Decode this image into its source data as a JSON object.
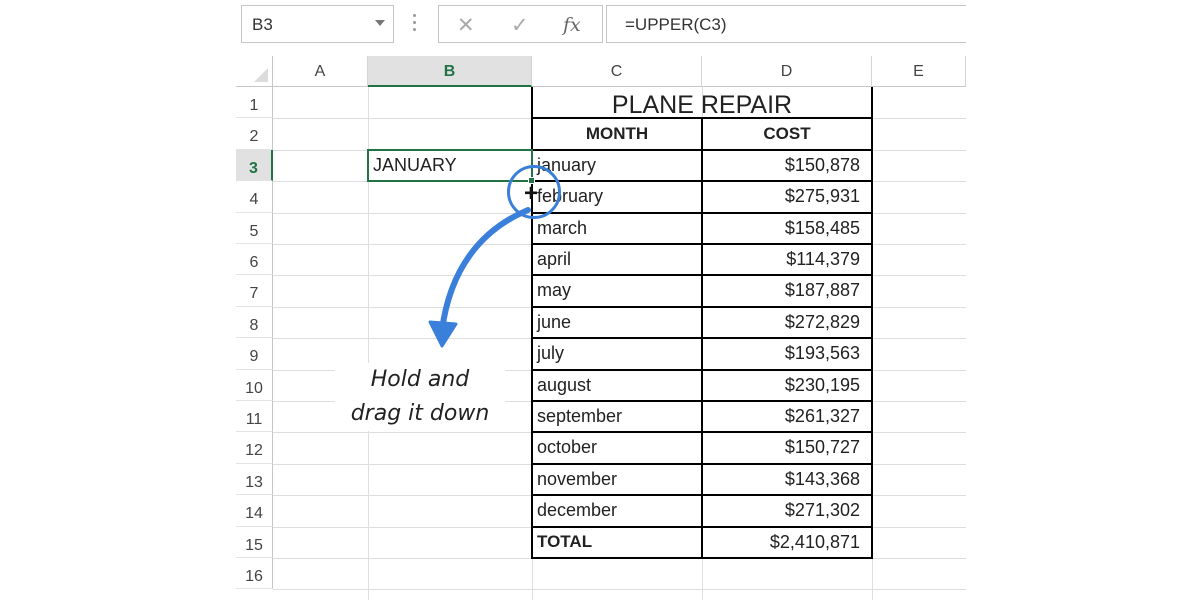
{
  "formula_bar": {
    "name_box": "B3",
    "cancel_icon": "✕",
    "enter_icon": "✓",
    "fx_label": "fx",
    "formula": "=UPPER(C3)"
  },
  "columns": [
    "A",
    "B",
    "C",
    "D",
    "E"
  ],
  "rows": [
    "1",
    "2",
    "3",
    "4",
    "5",
    "6",
    "7",
    "8",
    "9",
    "10",
    "11",
    "12",
    "13",
    "14",
    "15",
    "16"
  ],
  "selected_cell": {
    "column": "B",
    "row": "3",
    "value": "JANUARY"
  },
  "table": {
    "title": "PLANE REPAIR",
    "headers": {
      "month": "MONTH",
      "cost": "COST"
    },
    "rows": [
      {
        "month": "january",
        "cost": "$150,878"
      },
      {
        "month": "february",
        "cost": "$275,931"
      },
      {
        "month": "march",
        "cost": "$158,485"
      },
      {
        "month": "april",
        "cost": "$114,379"
      },
      {
        "month": "may",
        "cost": "$187,887"
      },
      {
        "month": "june",
        "cost": "$272,829"
      },
      {
        "month": "july",
        "cost": "$193,563"
      },
      {
        "month": "august",
        "cost": "$230,195"
      },
      {
        "month": "september",
        "cost": "$261,327"
      },
      {
        "month": "october",
        "cost": "$150,727"
      },
      {
        "month": "november",
        "cost": "$143,368"
      },
      {
        "month": "december",
        "cost": "$271,302"
      }
    ],
    "total": {
      "label": "TOTAL",
      "cost": "$2,410,871"
    }
  },
  "annotation": {
    "line1": "Hold and",
    "line2": "drag it down",
    "color": "#3a7fd9"
  },
  "accent_color": "#217346"
}
